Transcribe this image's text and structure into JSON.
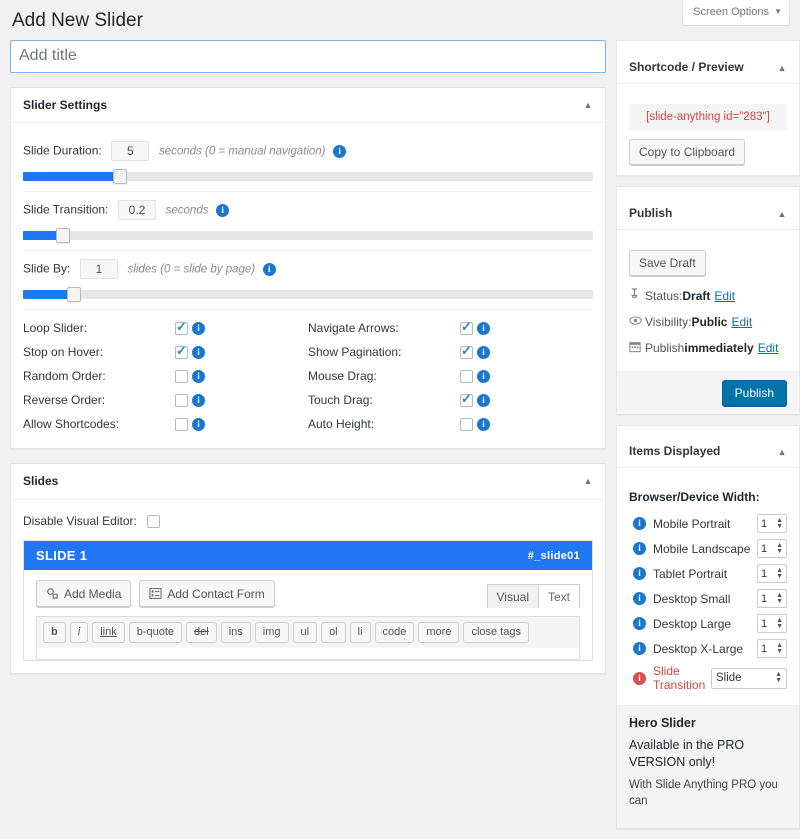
{
  "screen_options": {
    "label": "Screen Options",
    "caret": "▼"
  },
  "page_title": "Add New Slider",
  "title_field": {
    "placeholder": "Add title",
    "value": ""
  },
  "slider_settings": {
    "heading": "Slider Settings",
    "collapse_icon": "▲",
    "rows": [
      {
        "label": "Slide Duration:",
        "value": "5",
        "hint": "seconds (0 = manual navigation)",
        "info": "i",
        "fill_pct": 17
      },
      {
        "label": "Slide Transition:",
        "value": "0.2",
        "hint": "seconds",
        "info": "i",
        "fill_pct": 7
      },
      {
        "label": "Slide By:",
        "value": "1",
        "hint": "slides (0 = slide by page)",
        "info": "i",
        "fill_pct": 9
      }
    ],
    "checkboxes_left": [
      {
        "label": "Loop Slider:",
        "checked": true
      },
      {
        "label": "Stop on Hover:",
        "checked": true
      },
      {
        "label": "Random Order:",
        "checked": false
      },
      {
        "label": "Reverse Order:",
        "checked": false
      },
      {
        "label": "Allow Shortcodes:",
        "checked": false
      }
    ],
    "checkboxes_right": [
      {
        "label": "Navigate Arrows:",
        "checked": true
      },
      {
        "label": "Show Pagination:",
        "checked": true
      },
      {
        "label": "Mouse Drag:",
        "checked": false
      },
      {
        "label": "Touch Drag:",
        "checked": true
      },
      {
        "label": "Auto Height:",
        "checked": false
      }
    ]
  },
  "slides": {
    "heading": "Slides",
    "collapse_icon": "▲",
    "disable_visual_editor_label": "Disable Visual Editor:",
    "disable_visual_editor_checked": false,
    "slide": {
      "title": "SLIDE 1",
      "anchor": "#_slide01",
      "add_media_label": "Add Media",
      "add_contact_form_label": "Add Contact Form",
      "tabs": [
        {
          "label": "Visual",
          "active": true
        },
        {
          "label": "Text",
          "active": false
        }
      ],
      "quicktags": [
        "b",
        "i",
        "link",
        "b-quote",
        "del",
        "ins",
        "img",
        "ul",
        "ol",
        "li",
        "code",
        "more",
        "close tags"
      ]
    }
  },
  "sidebar": {
    "shortcode_panel": {
      "heading": "Shortcode / Preview",
      "collapse_icon": "▲",
      "shortcode": "[slide-anything id=\"283\"]",
      "copy_label": "Copy to Clipboard"
    },
    "publish_panel": {
      "heading": "Publish",
      "collapse_icon": "▲",
      "save_draft_label": "Save Draft",
      "rows": [
        {
          "icon": "pin",
          "prefix": "Status: ",
          "value": "Draft",
          "suffix": "",
          "edit": "Edit"
        },
        {
          "icon": "eye",
          "prefix": "Visibility: ",
          "value": "Public",
          "suffix": "",
          "edit": "Edit"
        },
        {
          "icon": "calendar",
          "prefix": "Publish ",
          "value": "immediately",
          "suffix": "",
          "edit": "Edit"
        }
      ],
      "publish_label": "Publish"
    },
    "items_displayed": {
      "heading": "Items Displayed",
      "collapse_icon": "▲",
      "subheading": "Browser/Device Width:",
      "devices": [
        {
          "label": "Mobile Portrait",
          "value": "1"
        },
        {
          "label": "Mobile Landscape",
          "value": "1"
        },
        {
          "label": "Tablet Portrait",
          "value": "1"
        },
        {
          "label": "Desktop Small",
          "value": "1"
        },
        {
          "label": "Desktop Large",
          "value": "1"
        },
        {
          "label": "Desktop X-Large",
          "value": "1"
        }
      ],
      "transition": {
        "label": "Slide Transition",
        "value": "Slide"
      },
      "hero": {
        "title": "Hero Slider",
        "line1": "Available in the PRO VERSION only!",
        "line2": "With Slide Anything PRO you can"
      }
    }
  },
  "colors": {
    "accent_blue": "#2176f3",
    "wp_blue": "#0073aa",
    "info_blue": "#1b77c9",
    "shortcode_red": "#cf4646"
  }
}
